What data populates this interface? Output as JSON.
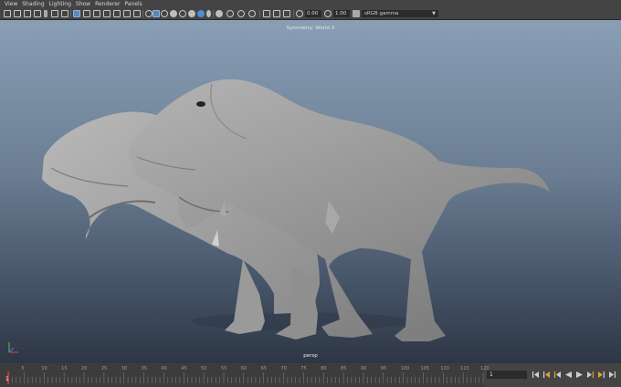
{
  "menu": [
    "View",
    "Shading",
    "Lighting",
    "Show",
    "Renderer",
    "Panels"
  ],
  "toolbar": {
    "exposure_value": "0.00",
    "gamma_value": "1.00",
    "color_space": "sRGB gamma"
  },
  "viewport": {
    "symmetry_label": "Symmetry: World X",
    "camera_label": "persp"
  },
  "timeline": {
    "tick_labels": [
      "5",
      "10",
      "15",
      "20",
      "25",
      "30",
      "35",
      "40",
      "45",
      "50",
      "55",
      "60",
      "65",
      "70",
      "75",
      "80",
      "85",
      "90",
      "95",
      "100",
      "105",
      "110",
      "115",
      "120"
    ],
    "current_frame": "1",
    "frame_field_value": "1"
  },
  "colors": {
    "viewport_top": "#899fb6",
    "viewport_bottom": "#2d3644",
    "accent": "#4a8fd0",
    "current_frame_marker": "#c0392b",
    "playback_active": "#e0a030"
  }
}
